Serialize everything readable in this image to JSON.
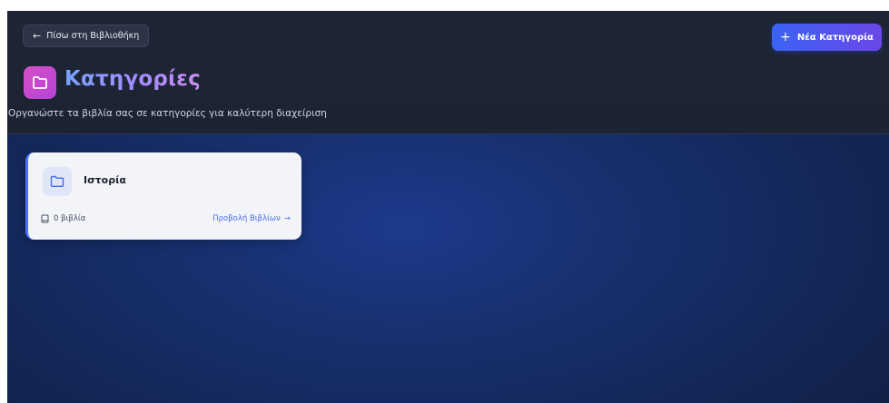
{
  "header": {
    "back_label": "Πίσω στη Βιβλιοθήκη",
    "new_category_label": "Νέα Κατηγορία",
    "title": "Κατηγορίες",
    "subtitle": "Οργανώστε τα βιβλία σας σε κατηγορίες για καλύτερη διαχείριση"
  },
  "categories": [
    {
      "name": "Ιστορία",
      "book_count": "0 βιβλία",
      "view_label": "Προβολή Βιβλίων"
    }
  ],
  "icons": {
    "back": "arrow-left-icon",
    "new": "plus-icon",
    "title": "folder-icon",
    "card": "folder-icon",
    "count": "book-icon",
    "link": "arrow-right-icon"
  },
  "colors": {
    "accent": "#3b63f2",
    "accent_secondary": "#6a47e8",
    "title_icon": "#d94fc5",
    "link": "#4a6cf0"
  }
}
